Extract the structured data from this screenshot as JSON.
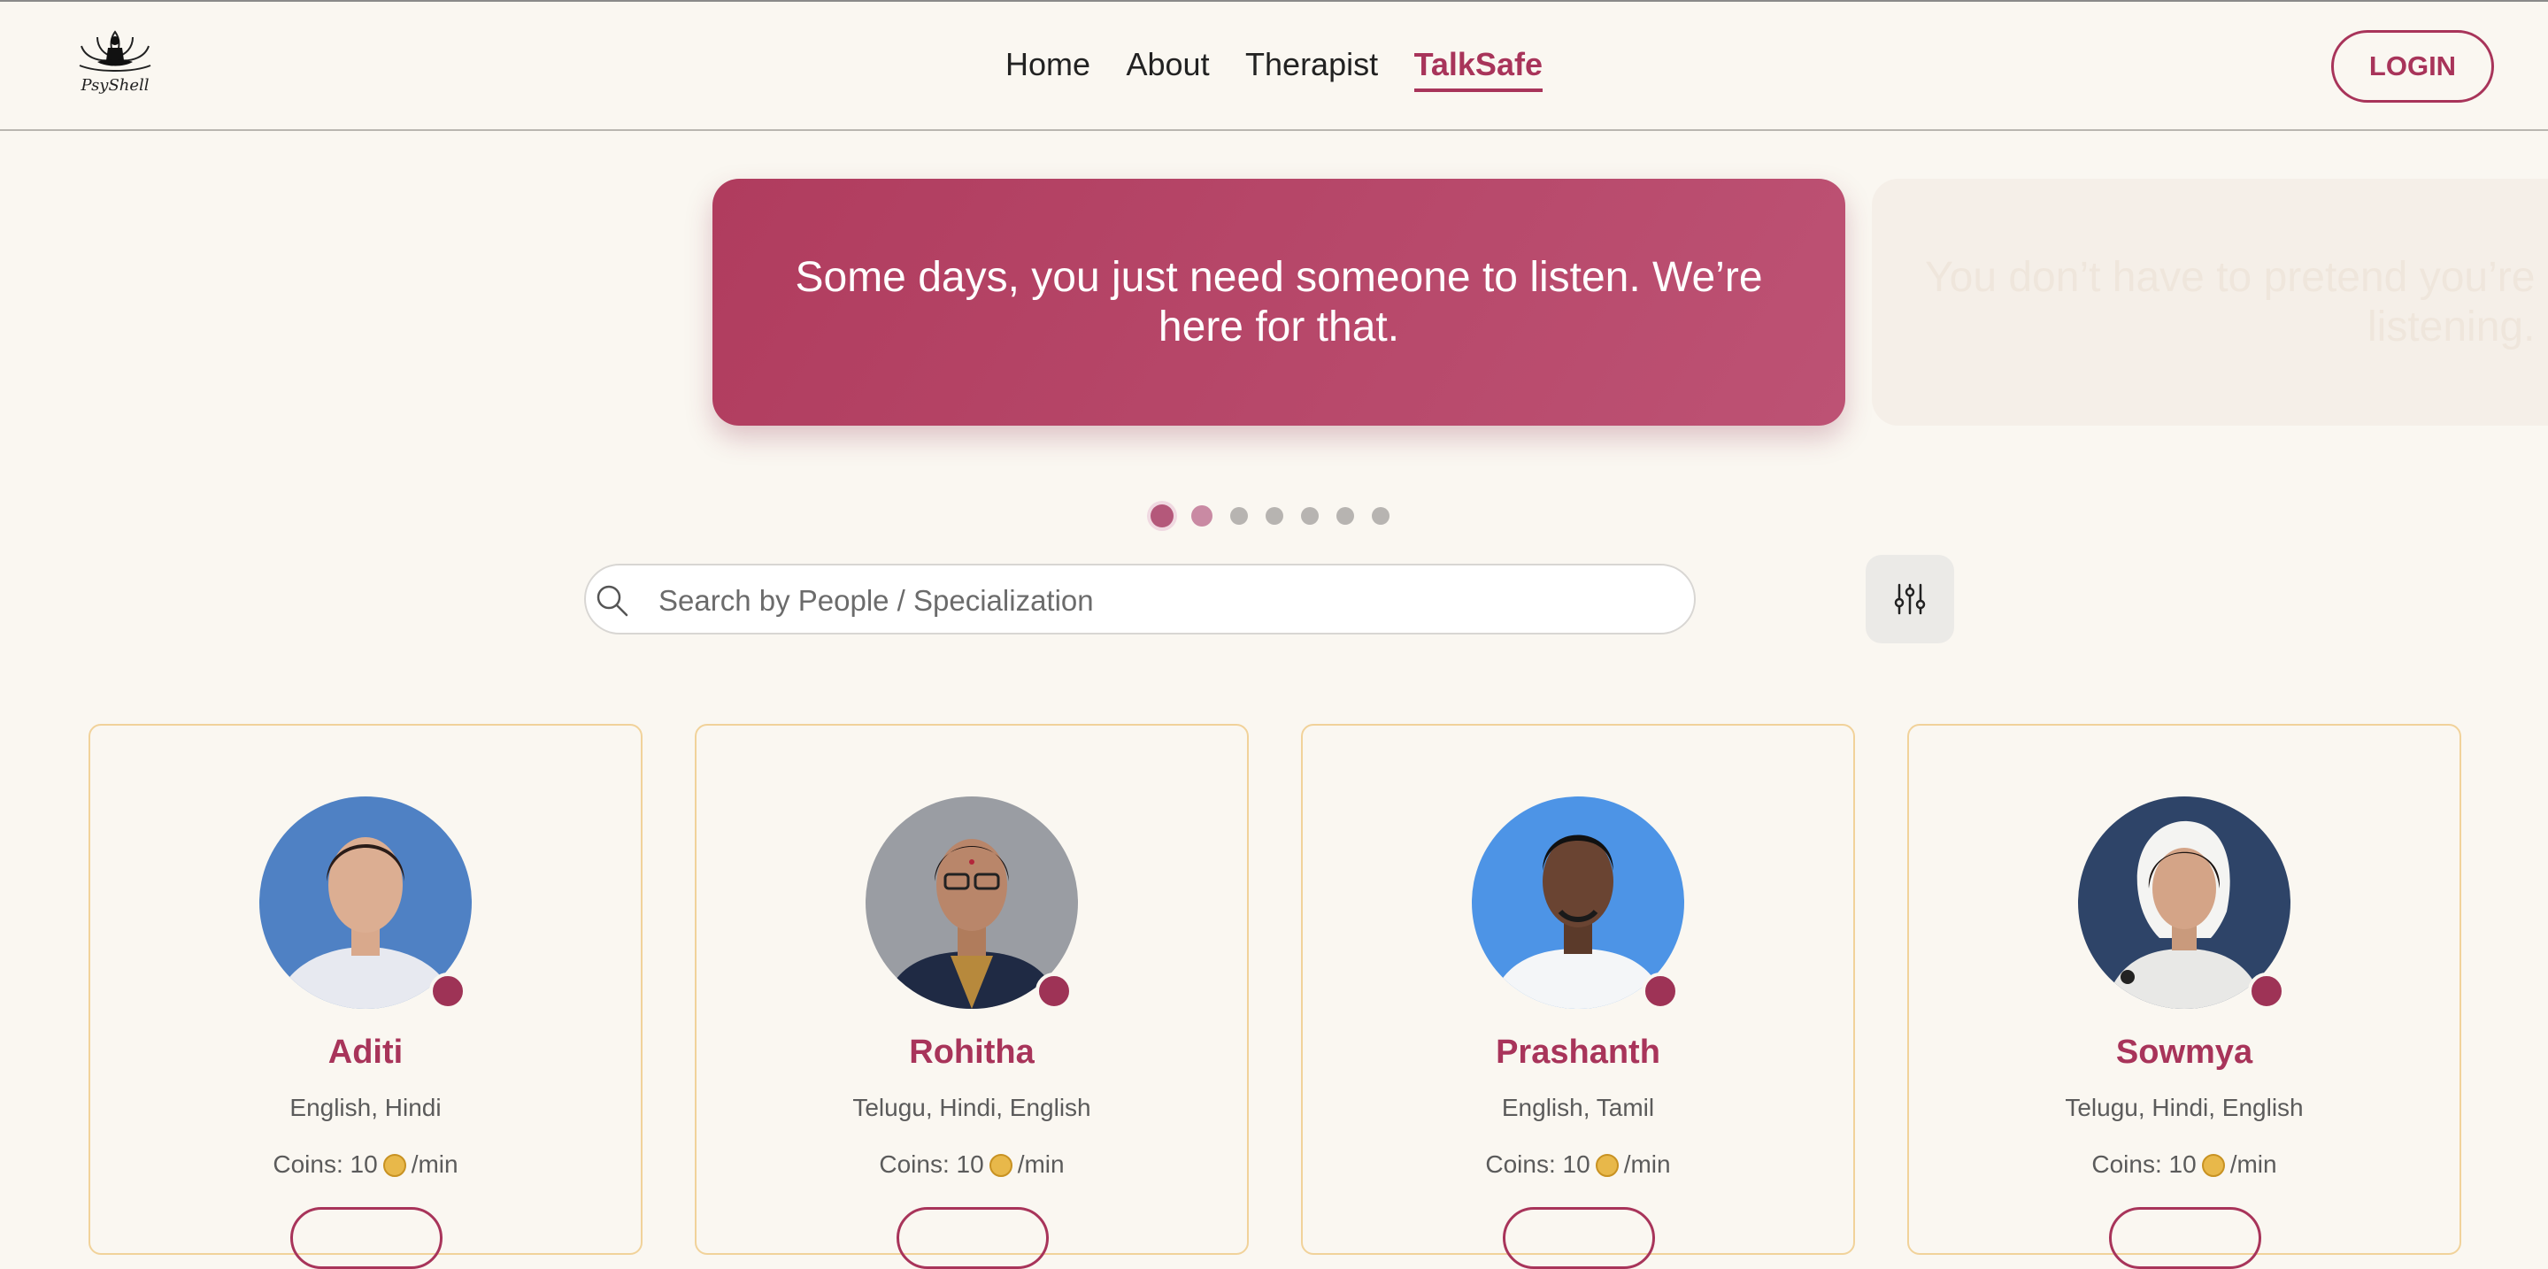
{
  "header": {
    "logo_text": "PsyShell",
    "nav": [
      "Home",
      "About",
      "Therapist",
      "TalkSafe"
    ],
    "active_nav": "TalkSafe",
    "login_label": "LOGIN"
  },
  "carousel": {
    "current_quote": "Some days, you just need someone to listen. We’re here for that.",
    "next_quote_line1": "You don’t have to pretend you’re",
    "next_quote_line2": "listening.",
    "slide_count": 7,
    "active_index": 0
  },
  "search": {
    "placeholder": "Search by People / Specialization"
  },
  "filter": {
    "icon": "sliders-icon"
  },
  "colors": {
    "accent": "#a8345a",
    "background": "#faf7f1",
    "card_border": "#f1d29a"
  },
  "therapists": [
    {
      "name": "Aditi",
      "languages": "English, Hindi",
      "coins_label": "Coins: 10",
      "rate_suffix": "/min"
    },
    {
      "name": "Rohitha",
      "languages": "Telugu, Hindi, English",
      "coins_label": "Coins: 10",
      "rate_suffix": "/min"
    },
    {
      "name": "Prashanth",
      "languages": "English, Tamil",
      "coins_label": "Coins: 10",
      "rate_suffix": "/min"
    },
    {
      "name": "Sowmya",
      "languages": "Telugu, Hindi, English",
      "coins_label": "Coins: 10",
      "rate_suffix": "/min"
    }
  ]
}
